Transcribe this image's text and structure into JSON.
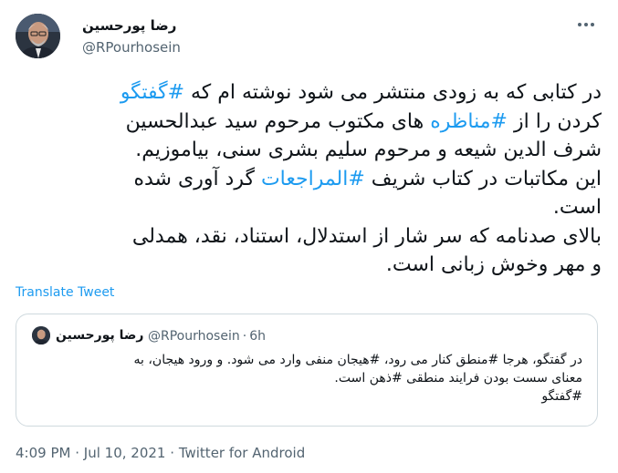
{
  "author": {
    "name": "رضا پورحسین",
    "handle": "@RPourhosein",
    "avatar_icon": "profile-photo-icon"
  },
  "tweet": {
    "lines": [
      [
        {
          "text": "در کتابی که به زودی منتشر می شود نوشته ام که ",
          "hashtag": false
        },
        {
          "text": "#گفتگو",
          "hashtag": true
        }
      ],
      [
        {
          "text": "کردن را از ",
          "hashtag": false
        },
        {
          "text": "#مناظره",
          "hashtag": true
        },
        {
          "text": " های مکتوب مرحوم سید عبدالحسین",
          "hashtag": false
        }
      ],
      [
        {
          "text": "شرف الدین شیعه و مرحوم سلیم بشری سنی، بیاموزیم.",
          "hashtag": false
        }
      ],
      [
        {
          "text": "این مکاتبات در کتاب شریف ",
          "hashtag": false
        },
        {
          "text": "#المراجعات",
          "hashtag": true
        },
        {
          "text": " گرد آوری شده",
          "hashtag": false
        }
      ],
      [
        {
          "text": "است.",
          "hashtag": false
        }
      ],
      [
        {
          "text": "بالای صدنامه که سر شار از استدلال، استناد، نقد، همدلی",
          "hashtag": false
        }
      ],
      [
        {
          "text": "و مهر وخوش زبانی است.",
          "hashtag": false
        }
      ]
    ]
  },
  "translate_label": "Translate Tweet",
  "quoted": {
    "name": "رضا پورحسین",
    "handle": "@RPourhosein",
    "separator": "·",
    "time": "6h",
    "lines": [
      "در گفتگو، هرجا #منطق کنار می رود، #هیجان منفی وارد می شود. و ورود هیجان، به",
      "معنای سست بودن فرایند منطقی #ذهن است.",
      "#گفتگو"
    ]
  },
  "meta": {
    "time": "4:09 PM",
    "date": "Jul 10, 2021",
    "source": "Twitter for Android",
    "separator": "·"
  },
  "colors": {
    "link": "#1d9bf0",
    "text": "#0f1419",
    "secondary": "#536471",
    "border": "#cfd9de"
  }
}
